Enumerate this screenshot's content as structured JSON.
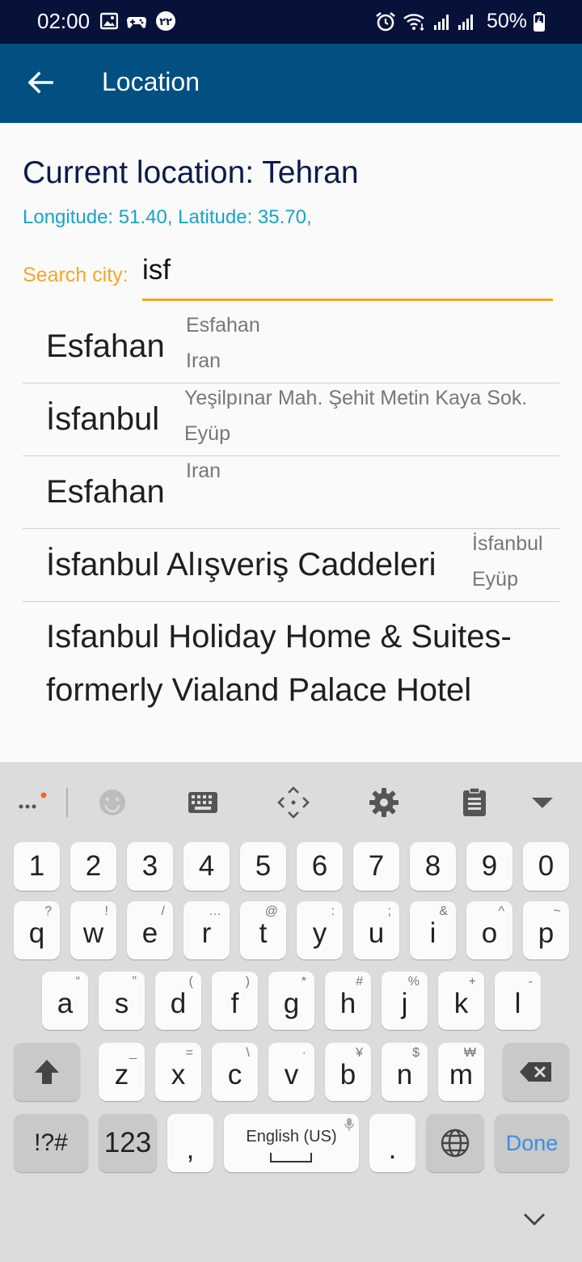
{
  "status_bar": {
    "time": "02:00",
    "battery": "50%",
    "left_icons": [
      "image-icon",
      "game-controller-icon",
      "persian-22-badge-icon"
    ],
    "right_icons": [
      "alarm-icon",
      "wifi-icon",
      "signal-icon",
      "signal-icon",
      "battery-charging-icon"
    ]
  },
  "app_bar": {
    "title": "Location",
    "back_icon": "arrow-left-icon",
    "color": "#024f82"
  },
  "location": {
    "current": "Current location: Tehran",
    "coords": "Longitude: 51.40, Latitude: 35.70,"
  },
  "search": {
    "label": "Search city:",
    "value": "isf",
    "accent": "#f5a623"
  },
  "results": [
    {
      "name": "Esfahan",
      "line1": "Esfahan",
      "line2": "Iran"
    },
    {
      "name": "İsfanbul",
      "line1": "Yeşilpınar Mah. Şehit Metin Kaya Sok.",
      "line2": "Eyüp"
    },
    {
      "name": "Esfahan",
      "line1": "Iran",
      "line2": ""
    },
    {
      "name": "İsfanbul Alışveriş Caddeleri",
      "line1": "İsfanbul",
      "line2": "Eyüp"
    },
    {
      "name": "Isfanbul Holiday Home & Suites-formerly Vialand Palace Hotel",
      "line1": "",
      "line2": ""
    }
  ],
  "keyboard": {
    "toolbar": [
      "more-icon",
      "emoji-icon",
      "keyboard-icon",
      "move-icon",
      "settings-icon",
      "clipboard-icon",
      "collapse-icon"
    ],
    "numbers": [
      "1",
      "2",
      "3",
      "4",
      "5",
      "6",
      "7",
      "8",
      "9",
      "0"
    ],
    "row1": [
      {
        "k": "q",
        "s": "?"
      },
      {
        "k": "w",
        "s": "!"
      },
      {
        "k": "e",
        "s": "/"
      },
      {
        "k": "r",
        "s": "…"
      },
      {
        "k": "t",
        "s": "@"
      },
      {
        "k": "y",
        "s": ":"
      },
      {
        "k": "u",
        "s": ";"
      },
      {
        "k": "i",
        "s": "&"
      },
      {
        "k": "o",
        "s": "^"
      },
      {
        "k": "p",
        "s": "~"
      }
    ],
    "row2": [
      {
        "k": "a",
        "s": "“"
      },
      {
        "k": "s",
        "s": "”"
      },
      {
        "k": "d",
        "s": "("
      },
      {
        "k": "f",
        "s": ")"
      },
      {
        "k": "g",
        "s": "*"
      },
      {
        "k": "h",
        "s": "#"
      },
      {
        "k": "j",
        "s": "%"
      },
      {
        "k": "k",
        "s": "+"
      },
      {
        "k": "l",
        "s": "-"
      }
    ],
    "row3": [
      {
        "k": "z",
        "s": "_"
      },
      {
        "k": "x",
        "s": "="
      },
      {
        "k": "c",
        "s": "\\"
      },
      {
        "k": "v",
        "s": "·"
      },
      {
        "k": "b",
        "s": "¥"
      },
      {
        "k": "n",
        "s": "$"
      },
      {
        "k": "m",
        "s": "₩"
      }
    ],
    "symbols_label": "!?#",
    "numbers_label": "123",
    "comma": ",",
    "space_label": "English (US)",
    "period": ".",
    "done_label": "Done"
  }
}
